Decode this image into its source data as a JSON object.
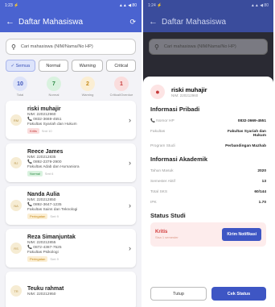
{
  "list_screen": {
    "status_time": "1:23 ⚡",
    "status_icons": "▲▲ ◀ 80",
    "title": "Daftar Mahasiswa",
    "search_placeholder": "Cari mahasiswa (NIM/Nama/No HP)",
    "filters": [
      {
        "label": "✓ Semua"
      },
      {
        "label": "Normal"
      },
      {
        "label": "Warning"
      },
      {
        "label": "Critical"
      }
    ],
    "stats": [
      {
        "value": "10",
        "label": "Total",
        "bg": "#dde3f9",
        "fg": "#3b52b8"
      },
      {
        "value": "7",
        "label": "Normal",
        "bg": "#d9f2df",
        "fg": "#2e8b47"
      },
      {
        "value": "2",
        "label": "Warning",
        "bg": "#fbeed3",
        "fg": "#c68b1a"
      },
      {
        "value": "1",
        "label": "Critical/Overdue",
        "bg": "#fadddd",
        "fg": "#c63a3a"
      }
    ],
    "students": [
      {
        "name": "riski muhajir",
        "nim": "NIM: 220212960",
        "phone": "📞 0832-3669-4551",
        "faculty": "Fakultas Syariah dan Hukum",
        "status": "Kritis",
        "status_bg": "#fadddd",
        "status_fg": "#c63a3a",
        "semester": "Smt 10",
        "initials": "RM"
      },
      {
        "name": "Reece James",
        "nim": "NIM: 220212835",
        "phone": "📞 0892-2379-2900",
        "faculty": "Fakultas Adab dan Humaniora",
        "status": "Normal",
        "status_bg": "#d9f2df",
        "status_fg": "#2e8b47",
        "semester": "Smt 6",
        "initials": "RJ"
      },
      {
        "name": "Nanda Aulia",
        "nim": "NIM: 220212850",
        "phone": "📞 0892-3647-1235",
        "faculty": "Fakultas Sains dan Teknologi",
        "status": "Peringatan",
        "status_bg": "#fbeed3",
        "status_fg": "#c68b1a",
        "semester": "Smt 9",
        "initials": "NA"
      },
      {
        "name": "Reza Simanjuntak",
        "nim": "NIM: 220212855",
        "phone": "📞 0872-4387-7525",
        "faculty": "Fakultas Psikologi",
        "status": "Peringatan",
        "status_bg": "#fbeed3",
        "status_fg": "#c68b1a",
        "semester": "Smt 9",
        "initials": "RS"
      },
      {
        "name": "Teuku rahmat",
        "nim": "NIM: 220212950",
        "phone": "",
        "faculty": "",
        "status": "",
        "status_bg": "#ffffff",
        "status_fg": "#ffffff",
        "semester": "",
        "initials": "TR"
      }
    ]
  },
  "detail_screen": {
    "status_time": "1:24 ⚡",
    "status_icons": "▲▲ ◀ 80",
    "title": "Daftar Mahasiswa",
    "search_placeholder": "Cari mahasiswa (NIM/Nama/No HP)",
    "name": "riski muhajir",
    "nim": "NIM: 220212960",
    "sections": {
      "personal": "Informasi Pribadi",
      "academic": "Informasi Akademik",
      "status": "Status Studi"
    },
    "personal_rows": [
      {
        "label": "📞 Nomor HP",
        "value": "0832-3669-4551"
      },
      {
        "label": "Fakultas",
        "value": "Fakultas Syariah dan Hukum"
      },
      {
        "label": "Program Studi",
        "value": "Perbandingan Mazhab"
      }
    ],
    "academic_rows": [
      {
        "label": "Tahun Masuk",
        "value": "2020"
      },
      {
        "label": "Semester Aktif",
        "value": "13"
      },
      {
        "label": "Total SKS",
        "value": "60/144"
      },
      {
        "label": "IPK",
        "value": "1.70"
      }
    ],
    "status_label": "Kritis",
    "status_sub": "Sisa 1 semester",
    "notify_button": "Kirim Notifikasi",
    "close_button": "Tutup",
    "check_button": "Cek Status"
  }
}
